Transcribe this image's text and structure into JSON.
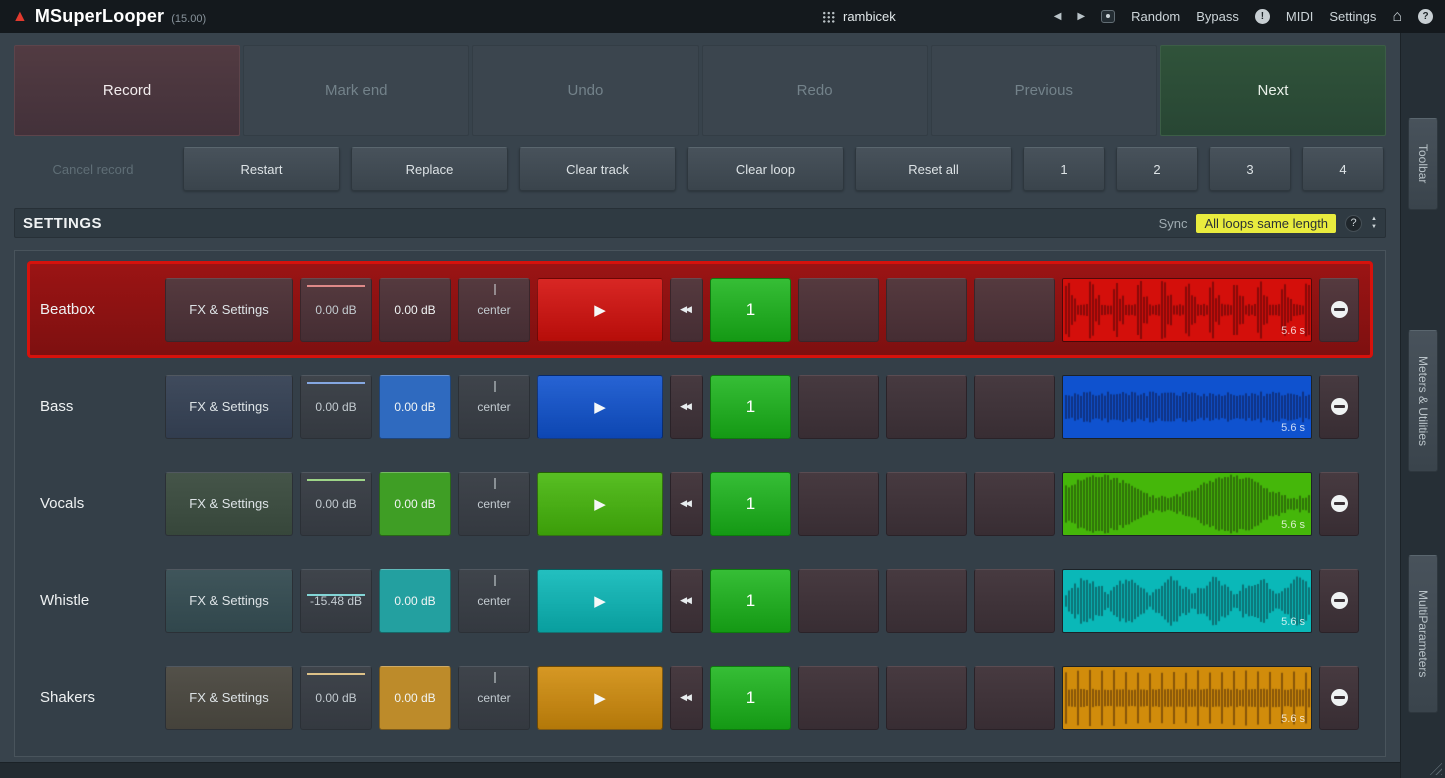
{
  "app": {
    "title": "MSuperLooper",
    "version": "(15.00)",
    "preset": "rambicek",
    "nav": {
      "random": "Random",
      "bypass": "Bypass",
      "midi": "MIDI",
      "settings": "Settings"
    }
  },
  "icons": {
    "logo": "▲",
    "prev": "◀",
    "next": "▶",
    "panic": "!",
    "home": "⌂",
    "help": "?",
    "play": "▶",
    "rewind": "◀◀",
    "spin_up": "▲",
    "spin_down": "▼"
  },
  "toolbar": {
    "big": [
      {
        "label": "Record",
        "style": "record"
      },
      {
        "label": "Mark end",
        "style": "dim"
      },
      {
        "label": "Undo",
        "style": "dim"
      },
      {
        "label": "Redo",
        "style": "dim"
      },
      {
        "label": "Previous",
        "style": "dim"
      },
      {
        "label": "Next",
        "style": "next"
      }
    ],
    "small": [
      {
        "label": "Cancel record",
        "style": "disabled"
      },
      {
        "label": "Restart",
        "style": "normal"
      },
      {
        "label": "Replace",
        "style": "normal"
      },
      {
        "label": "Clear track",
        "style": "normal"
      },
      {
        "label": "Clear loop",
        "style": "normal"
      },
      {
        "label": "Reset all",
        "style": "normal"
      },
      {
        "label": "1",
        "style": "num"
      },
      {
        "label": "2",
        "style": "num"
      },
      {
        "label": "3",
        "style": "num"
      },
      {
        "label": "4",
        "style": "num"
      }
    ]
  },
  "settings": {
    "title": "SETTINGS",
    "sync_label": "Sync",
    "sync_value": "All loops same length",
    "help": "?"
  },
  "colors": {
    "loop_green": "#18b418",
    "selected_red": "#d6120c",
    "sync_yellow": "#e9ec3e"
  },
  "tracks": [
    {
      "name": "Beatbox",
      "fx": "FX & Settings",
      "volume": "0.00 dB",
      "send": "0.00 dB",
      "pan": "center",
      "loop": "1",
      "length": "5.6 s",
      "color": "#d40f0b",
      "field2": "#802828",
      "selected": true,
      "pattern": "beat",
      "seed": 7,
      "vol_line": 0.09
    },
    {
      "name": "Bass",
      "fx": "FX & Settings",
      "volume": "0.00 dB",
      "send": "0.00 dB",
      "pan": "center",
      "loop": "1",
      "length": "5.6 s",
      "color": "#0f52cf",
      "field2": "#2f6abf",
      "selected": false,
      "pattern": "bass",
      "seed": 11,
      "vol_line": 0.09
    },
    {
      "name": "Vocals",
      "fx": "FX & Settings",
      "volume": "0.00 dB",
      "send": "0.00 dB",
      "pan": "center",
      "loop": "1",
      "length": "5.6 s",
      "color": "#45b70a",
      "field2": "#3f9e25",
      "selected": false,
      "pattern": "vocal",
      "seed": 5,
      "vol_line": 0.09
    },
    {
      "name": "Whistle",
      "fx": "FX & Settings",
      "volume": "-15.48 dB",
      "send": "0.00 dB",
      "pan": "center",
      "loop": "1",
      "length": "5.6 s",
      "color": "#0ab8b8",
      "field2": "#23a0a0",
      "selected": false,
      "pattern": "whistle",
      "seed": 9,
      "vol_line": 0.38
    },
    {
      "name": "Shakers",
      "fx": "FX & Settings",
      "volume": "0.00 dB",
      "send": "0.00 dB",
      "pan": "center",
      "loop": "1",
      "length": "5.6 s",
      "color": "#d18c0b",
      "field2": "#bd8b2a",
      "selected": false,
      "pattern": "shaker",
      "seed": 13,
      "vol_line": 0.09
    }
  ],
  "sidebar": {
    "tabs": [
      "Toolbar",
      "Meters & Utilities",
      "MultiParameters"
    ]
  }
}
